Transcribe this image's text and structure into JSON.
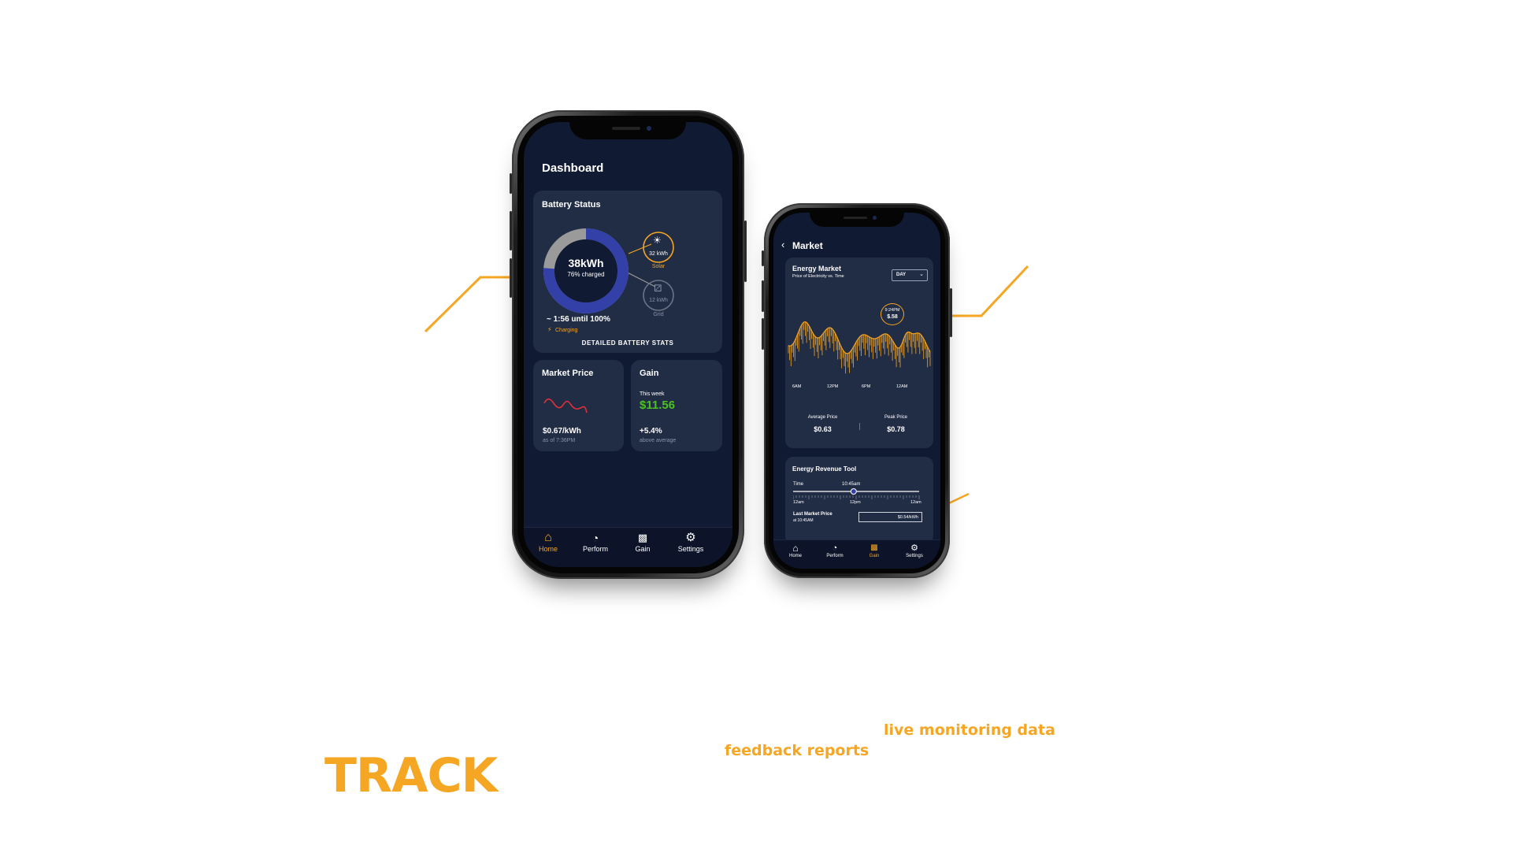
{
  "colors": {
    "accent": "#f5a623",
    "screen_bg": "#111a33",
    "card_bg": "#212c45",
    "gain_green": "#4cc21f",
    "ring_blue": "#3240a8",
    "ring_grey": "#9a9a9a",
    "price_red": "#e0303a"
  },
  "dashboard": {
    "title": "Dashboard",
    "battery": {
      "title": "Battery Status",
      "amount": "38kWh",
      "charged": "76% charged",
      "charged_fraction": 0.76,
      "solar_value": "32 kWh",
      "solar_label": "Solar",
      "grid_value": "12 kWh",
      "grid_label": "Grid",
      "time_until_full": "~ 1:56 until 100%",
      "status": "Charging",
      "stats_button": "DETAILED BATTERY STATS"
    },
    "market": {
      "title": "Market Price",
      "price": "$0.67/kWh",
      "as_of": "as of 7:36PM"
    },
    "gain": {
      "title": "Gain",
      "period": "This week",
      "amount": "$11.56",
      "change": "+5.4%",
      "change_label": "above average"
    },
    "nav": [
      "Home",
      "Perform",
      "Gain",
      "Settings"
    ],
    "nav_icons": [
      "home-icon",
      "gauge-icon",
      "bar-chart-icon",
      "gear-icon"
    ]
  },
  "market": {
    "back_icon": "chevron-left-icon",
    "title": "Market",
    "energy_market": {
      "title": "Energy Market",
      "subtitle": "Price of Electricity vs. Time",
      "range_selected": "DAY",
      "tooltip_time": "9:24PM",
      "tooltip_price": "$.58",
      "x_ticks": [
        "6AM",
        "12PM",
        "6PM",
        "12AM"
      ],
      "avg_label": "Average Price",
      "avg_value": "$0.63",
      "peak_label": "Peak Price",
      "peak_value": "$0.78"
    },
    "revenue_tool": {
      "title": "Energy Revenue Tool",
      "time_label": "Time",
      "time_value": "10:45am",
      "slider_fraction": 0.48,
      "ticks": [
        "12am",
        "12pm",
        "12am"
      ],
      "last_price_label": "Last Market Price",
      "last_price_time": "at 10:45AM",
      "last_price_value": "$0.54/kWh"
    },
    "nav": [
      "Home",
      "Perform",
      "Gain",
      "Settings"
    ],
    "nav_icons": [
      "home-icon",
      "gauge-icon",
      "bar-chart-icon",
      "gear-icon"
    ]
  },
  "captions": {
    "track": "TRACK",
    "feedback": "feedback reports",
    "live": "live monitoring data"
  }
}
